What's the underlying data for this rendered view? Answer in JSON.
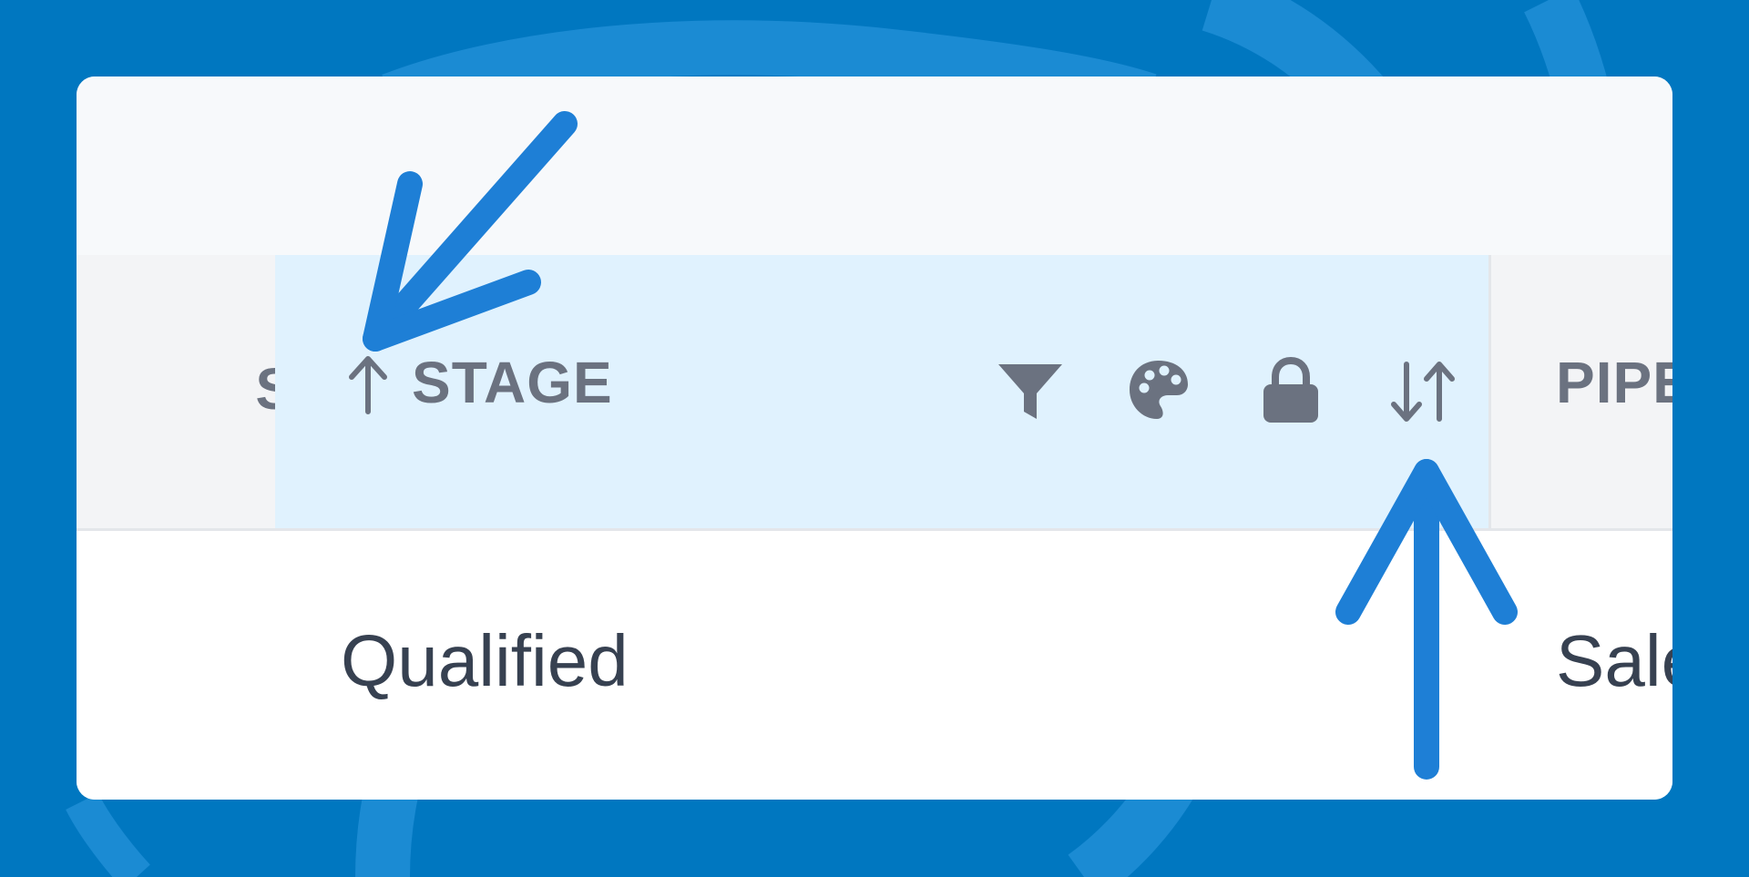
{
  "header": {
    "previous_column_label": "S",
    "stage_column_label": "STAGE",
    "next_column_label": "PIPE"
  },
  "icons": {
    "sort_indicator": "arrow-up-icon",
    "filter": "filter-icon",
    "color": "palette-icon",
    "lock": "lock-icon",
    "sort": "sort-icon"
  },
  "row": {
    "stage_value": "Qualified",
    "next_value": "Sale"
  },
  "colors": {
    "background": "#0077C0",
    "annotation_arrow": "#1E7FD6",
    "stage_header_highlight": "#E0F2FE",
    "header_text": "#6B7280"
  }
}
